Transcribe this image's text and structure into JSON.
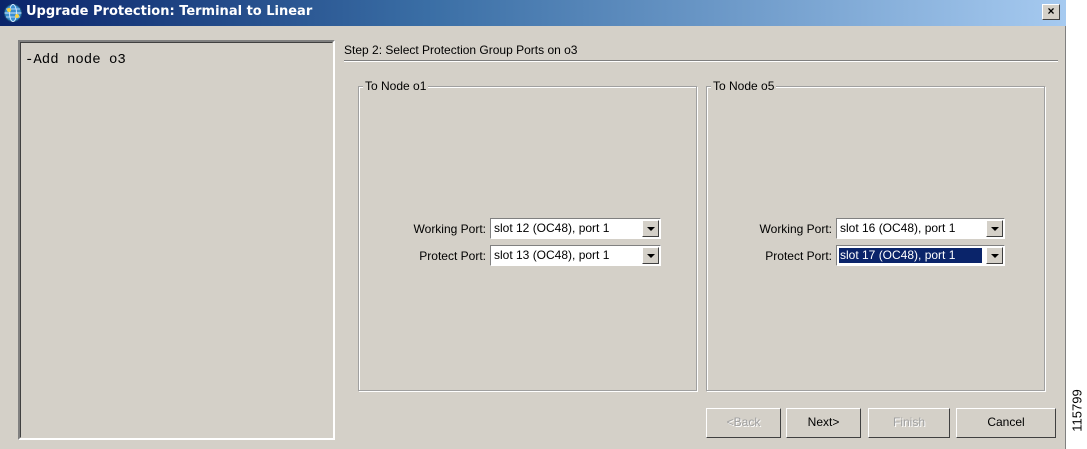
{
  "window": {
    "title": "Upgrade Protection: Terminal to Linear",
    "close_label": "×"
  },
  "left_panel": {
    "text": "-Add node o3"
  },
  "step": {
    "title": "Step 2: Select Protection Group Ports on o3"
  },
  "groups": [
    {
      "label": "To Node o1",
      "working_label": "Working Port:",
      "working_value": "slot 12 (OC48), port 1",
      "protect_label": "Protect Port:",
      "protect_value": "slot 13 (OC48), port 1"
    },
    {
      "label": "To Node o5",
      "working_label": "Working Port:",
      "working_value": "slot 16 (OC48), port 1",
      "protect_label": "Protect Port:",
      "protect_value": "slot 17 (OC48), port 1"
    }
  ],
  "buttons": {
    "back": "<Back",
    "next": "Next>",
    "finish": "Finish",
    "cancel": "Cancel"
  },
  "figure_id": "115799",
  "colors": {
    "titlebar_start": "#0a246a",
    "titlebar_end": "#a6caf0",
    "face": "#d4d0c8",
    "selection": "#0a246a"
  },
  "icons": {
    "title_icon": "network-globe-icon",
    "close": "close-icon",
    "combo_arrow": "dropdown-arrow-icon"
  }
}
